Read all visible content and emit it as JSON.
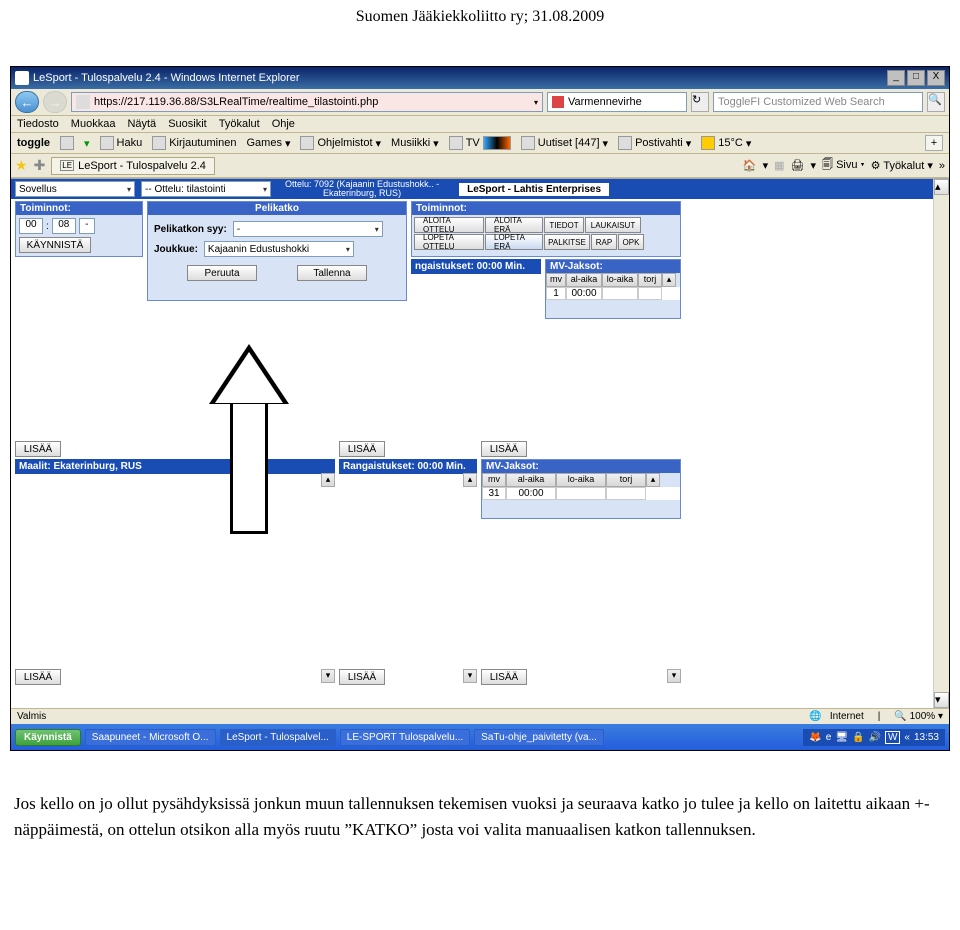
{
  "doc_header": "Suomen Jääkiekkoliitto ry; 31.08.2009",
  "titlebar": {
    "title": "LeSport - Tulospalvelu 2.4 - Windows Internet Explorer",
    "min": "_",
    "max": "□",
    "close": "X"
  },
  "address": {
    "url": "https://217.119.36.88/S3LRealTime/realtime_tilastointi.php",
    "security_text": "Varmennevirhe",
    "refresh_icon": "↻",
    "search_placeholder": "ToggleFI Customized Web Search",
    "search_icon": "🔍"
  },
  "menus": [
    "Tiedosto",
    "Muokkaa",
    "Näytä",
    "Suosikit",
    "Työkalut",
    "Ohje"
  ],
  "toolbar": {
    "brand": "toggle",
    "items": [
      "Haku",
      "Kirjautuminen",
      "Games",
      "Ohjelmistot",
      "Musiikki",
      "TV",
      "Uutiset [447]",
      "Postivahti",
      "15°C"
    ],
    "plus": "+"
  },
  "tabs": {
    "name": "LeSport - Tulospalvelu 2.4",
    "icon": "LE",
    "right": [
      "🏠",
      "🖨",
      "🗐",
      "Sivu",
      "Työkalut",
      "»"
    ]
  },
  "app": {
    "sovellus_label": "Sovellus",
    "ottelu_dd": "-- Ottelu: tilastointi",
    "ottelu_header": "Ottelu: 7092 (Kajaanin Edustushokk.. -\nEkaterinburg, RUS)",
    "brand_text": "LeSport - Lahtis Enterprises",
    "left": {
      "toiminnot": "Toiminnot:",
      "time1": "00",
      "time2": "08",
      "dash": "-",
      "kaynnista": "KÄYNNISTÄ",
      "maalit_hdr": "Maalit: Ekaterinburg, RUS",
      "lisaa": "LISÄÄ"
    },
    "center": {
      "pelikatko_hdr": "Pelikatko",
      "syy_label": "Pelikatkon syy:",
      "syy_value": "-",
      "joukkue_label": "Joukkue:",
      "joukkue_value": "Kajaanin Edustushokki",
      "peruuta": "Peruuta",
      "tallenna": "Tallenna",
      "rang_hdr": "ngaistukset: 00:00 Min.",
      "rang_hdr2": "Rangaistukset: 00:00 Min.",
      "lisaa": "LISÄÄ"
    },
    "right": {
      "toiminnot": "Toiminnot:",
      "buttons": [
        "ALOITA OTTELU",
        "ALOITA ERÄ",
        "TIEDOT",
        "LAUKAISUT",
        "LOPETA OTTELU",
        "LOPETA ERÄ",
        "PALKITSE",
        "RAP",
        "OPK"
      ],
      "mv_hdr": "MV-Jaksot:",
      "cols": [
        "mv",
        "al-aika",
        "lo-aika",
        "torj"
      ],
      "row1": [
        "1",
        "00:00",
        "",
        ""
      ],
      "row2": [
        "31",
        "00:00",
        "",
        ""
      ],
      "lisaa": "LISÄÄ"
    }
  },
  "statusbar": {
    "left": "Valmis",
    "zone": "Internet",
    "zoom": "100%"
  },
  "taskbar": {
    "start": "Käynnistä",
    "items": [
      "Saapuneet - Microsoft O...",
      "LeSport - Tulospalvel...",
      "LE-SPORT Tulospalvelu...",
      "SaTu-ohje_paivitetty (va..."
    ],
    "tray_prefix": "«",
    "time": "13:53"
  },
  "caption": "Jos kello on jo ollut pysähdyksissä jonkun muun tallennuksen tekemisen vuoksi ja seuraava katko jo tulee ja kello on laitettu aikaan +-näppäimestä, on ottelun otsikon alla myös ruutu ”KATKO” josta voi valita manuaalisen katkon tallennuksen."
}
